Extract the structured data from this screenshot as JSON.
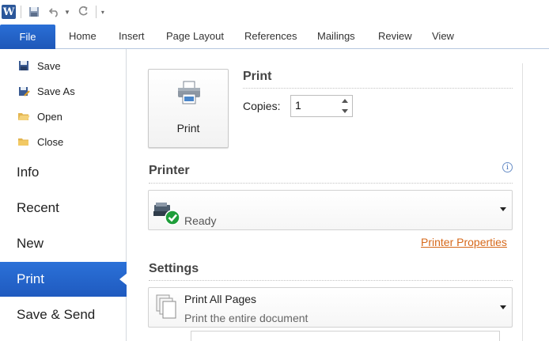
{
  "app": {
    "logo_letter": "W"
  },
  "ribbon": {
    "file_tab": "File",
    "tabs": [
      "Home",
      "Insert",
      "Page Layout",
      "References",
      "Mailings",
      "Review",
      "View"
    ]
  },
  "nav": {
    "small_items": [
      "Save",
      "Save As",
      "Open",
      "Close"
    ],
    "big_items": [
      "Info",
      "Recent",
      "New",
      "Print",
      "Save & Send"
    ],
    "active": "Print"
  },
  "print": {
    "section_title": "Print",
    "button_label": "Print",
    "copies_label": "Copies:",
    "copies_value": "1"
  },
  "printer": {
    "section_title": "Printer",
    "status": "Ready",
    "properties_link": "Printer Properties"
  },
  "settings": {
    "section_title": "Settings",
    "range_title": "Print All Pages",
    "range_subtitle": "Print the entire document"
  },
  "colors": {
    "accent": "#1f5abf",
    "link": "#d6681a",
    "ready_green": "#1e9e3a"
  }
}
